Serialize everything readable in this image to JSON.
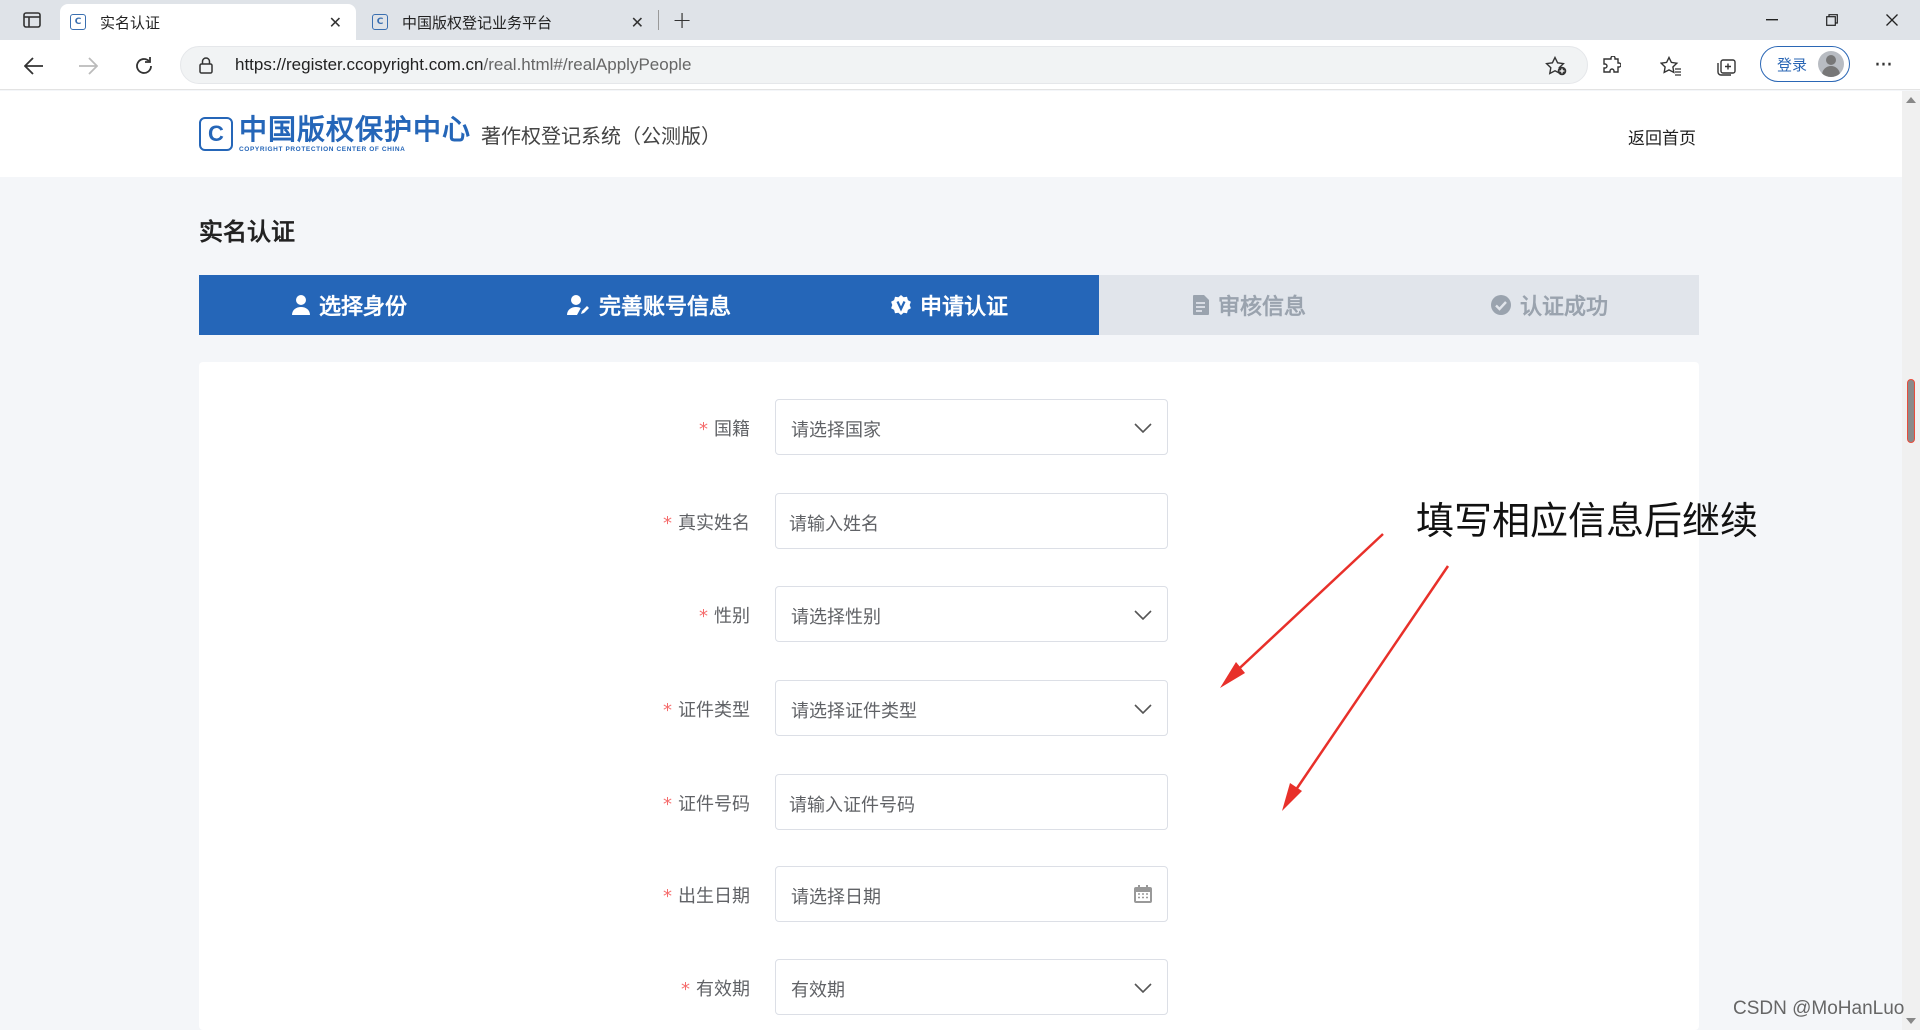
{
  "browser": {
    "tabs": [
      {
        "title": "实名认证",
        "favicon": "C",
        "active": true
      },
      {
        "title": "中国版权登记业务平台",
        "favicon": "C",
        "active": false
      }
    ],
    "address": {
      "url_host": "https://register.ccopyright.com.cn",
      "url_path": "/real.html#/realApplyPeople"
    },
    "login_label": "登录"
  },
  "header": {
    "logo_cn": "中国版权保护中心",
    "logo_en": "COPYRIGHT PROTECTION CENTER OF CHINA",
    "logo_mark": "C",
    "system_name": "著作权登记系统（公测版）",
    "home_link": "返回首页"
  },
  "page": {
    "title": "实名认证",
    "steps": [
      {
        "label": "选择身份",
        "icon": "user-icon",
        "state": "done"
      },
      {
        "label": "完善账号信息",
        "icon": "user-edit-icon",
        "state": "done"
      },
      {
        "label": "申请认证",
        "icon": "badge-v-icon",
        "state": "current"
      },
      {
        "label": "审核信息",
        "icon": "document-icon",
        "state": "todo"
      },
      {
        "label": "认证成功",
        "icon": "check-circle-icon",
        "state": "todo"
      }
    ],
    "form": [
      {
        "label": "国籍",
        "placeholder": "请选择国家",
        "type": "select",
        "required": true
      },
      {
        "label": "真实姓名",
        "placeholder": "请输入姓名",
        "type": "input",
        "required": true
      },
      {
        "label": "性别",
        "placeholder": "请选择性别",
        "type": "select",
        "required": true
      },
      {
        "label": "证件类型",
        "placeholder": "请选择证件类型",
        "type": "select",
        "required": true
      },
      {
        "label": "证件号码",
        "placeholder": "请输入证件号码",
        "type": "input",
        "required": true
      },
      {
        "label": "出生日期",
        "placeholder": "请选择日期",
        "type": "date",
        "required": true
      },
      {
        "label": "有效期",
        "placeholder": "有效期",
        "type": "select",
        "required": true
      }
    ],
    "required_mark": "*"
  },
  "annotation": {
    "text": "填写相应信息后继续",
    "color": "#e8302a"
  },
  "watermark": "CSDN @MoHanLuo",
  "colors": {
    "brand": "#2566b8",
    "step_todo_bg": "#e1e5eb",
    "required": "#f56c6c"
  }
}
